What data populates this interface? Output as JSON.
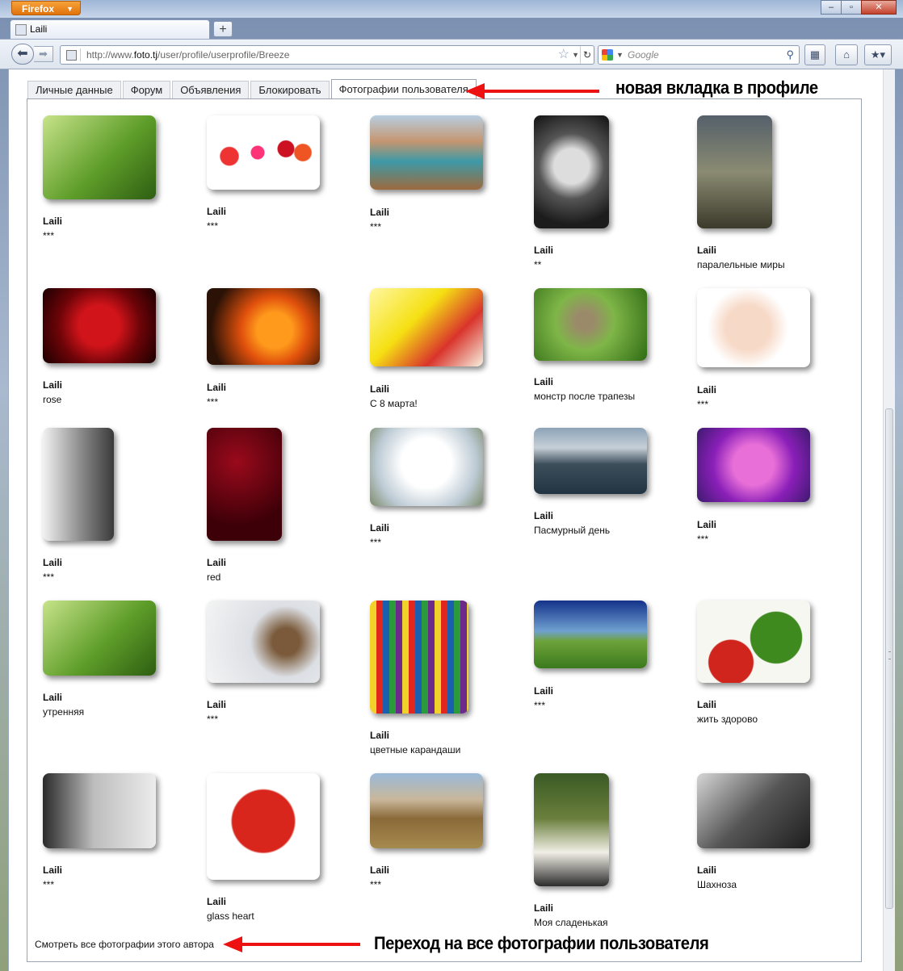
{
  "browser": {
    "menu_button": "Firefox",
    "tab_title": "Laili",
    "url_prefix": "http://www.",
    "url_domain": "foto.tj",
    "url_path": "/user/profile/userprofile/Breeze",
    "search_placeholder": "Google"
  },
  "profile_tabs": [
    "Личные данные",
    "Форум",
    "Объявления",
    "Блокировать",
    "Фотографии пользователя"
  ],
  "photos": [
    {
      "user": "Laili",
      "title": "***"
    },
    {
      "user": "Laili",
      "title": "***"
    },
    {
      "user": "Laili",
      "title": "***"
    },
    {
      "user": "Laili",
      "title": "**"
    },
    {
      "user": "Laili",
      "title": "паралельные миры"
    },
    {
      "user": "Laili",
      "title": "rose"
    },
    {
      "user": "Laili",
      "title": "***"
    },
    {
      "user": "Laili",
      "title": "С 8 марта!"
    },
    {
      "user": "Laili",
      "title": "монстр после трапезы"
    },
    {
      "user": "Laili",
      "title": "***"
    },
    {
      "user": "Laili",
      "title": "***"
    },
    {
      "user": "Laili",
      "title": "red"
    },
    {
      "user": "Laili",
      "title": "***"
    },
    {
      "user": "Laili",
      "title": "Пасмурный день"
    },
    {
      "user": "Laili",
      "title": "***"
    },
    {
      "user": "Laili",
      "title": "утренняя"
    },
    {
      "user": "Laili",
      "title": "***"
    },
    {
      "user": "Laili",
      "title": "цветные карандаши"
    },
    {
      "user": "Laili",
      "title": "***"
    },
    {
      "user": "Laili",
      "title": "жить здорово"
    },
    {
      "user": "Laili",
      "title": "***"
    },
    {
      "user": "Laili",
      "title": "glass heart"
    },
    {
      "user": "Laili",
      "title": "***"
    },
    {
      "user": "Laili",
      "title": "Моя сладенькая"
    },
    {
      "user": "Laili",
      "title": "Шахноза"
    }
  ],
  "all_photos_link": "Смотреть все фотографии этого автора",
  "annotations": {
    "new_tab": "новая вкладка в профиле",
    "all_photos": "Переход на все фотографии пользователя"
  },
  "colors": {
    "annotation_arrow": "#ee1111",
    "menu_button": "#e77a14"
  }
}
